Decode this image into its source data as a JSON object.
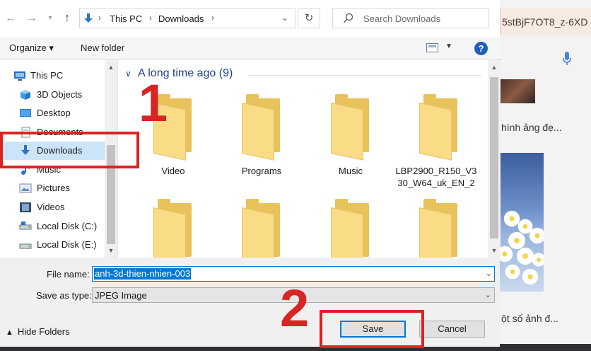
{
  "address_bar": {
    "crumbs": [
      "This PC",
      "Downloads"
    ],
    "refresh_icon": "refresh-icon"
  },
  "search": {
    "placeholder": "Search Downloads"
  },
  "toolbar": {
    "organize": "Organize ▾",
    "new_folder": "New folder",
    "help": "?"
  },
  "nav": {
    "items": [
      {
        "label": "This PC",
        "icon": "pc-icon"
      },
      {
        "label": "3D Objects",
        "icon": "cube-icon"
      },
      {
        "label": "Desktop",
        "icon": "desktop-icon"
      },
      {
        "label": "Documents",
        "icon": "document-icon"
      },
      {
        "label": "Downloads",
        "icon": "download-arrow-icon"
      },
      {
        "label": "Music",
        "icon": "music-icon"
      },
      {
        "label": "Pictures",
        "icon": "pictures-icon"
      },
      {
        "label": "Videos",
        "icon": "videos-icon"
      },
      {
        "label": "Local Disk (C:)",
        "icon": "drive-icon"
      },
      {
        "label": "Local Disk (E:)",
        "icon": "drive-icon"
      }
    ],
    "selected": "Downloads"
  },
  "content": {
    "group_header": "A long time ago (9)",
    "folders": [
      {
        "label": "Video"
      },
      {
        "label": "Programs"
      },
      {
        "label": "Music"
      },
      {
        "label": "LBP2900_R150_V330_W64_uk_EN_2"
      }
    ]
  },
  "form": {
    "file_name_label": "File name:",
    "file_name_value": "anh-3d-thien-nhien-003",
    "save_type_label": "Save as type:",
    "save_type_value": "JPEG Image"
  },
  "footer": {
    "hide_folders": "Hide Folders",
    "save": "Save",
    "cancel": "Cancel"
  },
  "annotations": {
    "step1": "1",
    "step2": "2",
    "color": "#d92424"
  },
  "background": {
    "url_fragment": "5stBjF7OT8_z-6XD",
    "text1": "hình ảng đẹ...",
    "text2": "ột số ảnh đ..."
  },
  "colors": {
    "accent": "#0078d7",
    "folder": "#f9dc85",
    "selection": "#cce4f7"
  }
}
